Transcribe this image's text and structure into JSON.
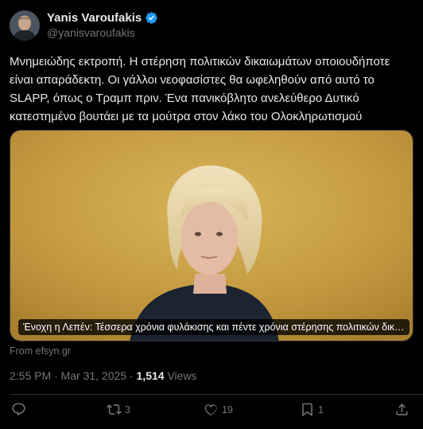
{
  "author": {
    "display_name": "Yanis Varoufakis",
    "handle": "@yanisvaroufakis",
    "verified": true
  },
  "post": {
    "text": "Μνημειώδης εκτροπή. Η στέρηση πολιτικών δικαιωμάτων οποιουδήποτε είναι απαράδεκτη. Οι γάλλοι νεοφασίστες θα ωφεληθούν από αυτό το SLAPP, όπως ο Τραμπ πριν. Ένα πανικόβλητο ανελεύθερο Δυτικό κατεστημένο βουτάει με τα μούτρα στον λάκο του Ολοκληρωτισμού",
    "timestamp": "2:55 PM · Mar 31, 2025 · ",
    "views_count": "1,514",
    "views_label": " Views"
  },
  "link_card": {
    "caption": "Ένοχη η Λεπέν: Τέσσερα χρόνια φυλάκισης και πέντε χρόνια στέρησης πολιτικών δικαιωμάτων",
    "source": "From efsyn.gr"
  },
  "actions": {
    "reply_icon": "reply-icon",
    "repost_count": "3",
    "like_count": "19",
    "bookmark_count": "1",
    "share_icon": "share-icon"
  },
  "colors": {
    "background": "#000000",
    "text_primary": "#e7e9ea",
    "text_secondary": "#71767b",
    "verified_blue": "#1d9bf0"
  }
}
